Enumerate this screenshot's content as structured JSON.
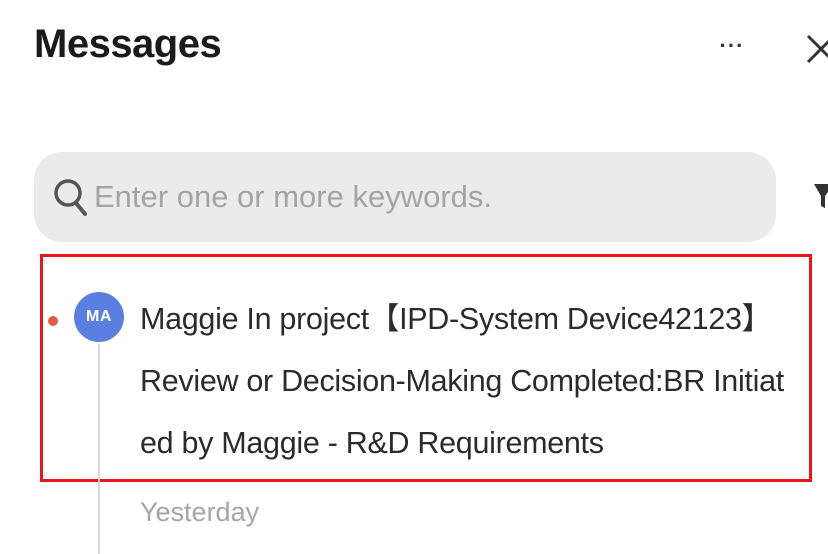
{
  "header": {
    "title": "Messages",
    "more_label": "···"
  },
  "search": {
    "placeholder": "Enter one or more keywords.",
    "value": ""
  },
  "messages": [
    {
      "avatar_initials": "MA",
      "unread": true,
      "text": "Maggie In project【IPD-System Device42123】Review or Decision-Making Completed:BR Initiated by Maggie - R&D Requirements",
      "time": "Yesterday"
    }
  ],
  "colors": {
    "highlight_border": "#e8151b",
    "avatar_bg": "#5b7fe0",
    "unread_dot": "#e5584b",
    "search_bg": "#ebebeb"
  },
  "icons": {
    "search": "search-icon",
    "more": "more-icon",
    "close": "close-icon",
    "filter": "filter-icon"
  }
}
